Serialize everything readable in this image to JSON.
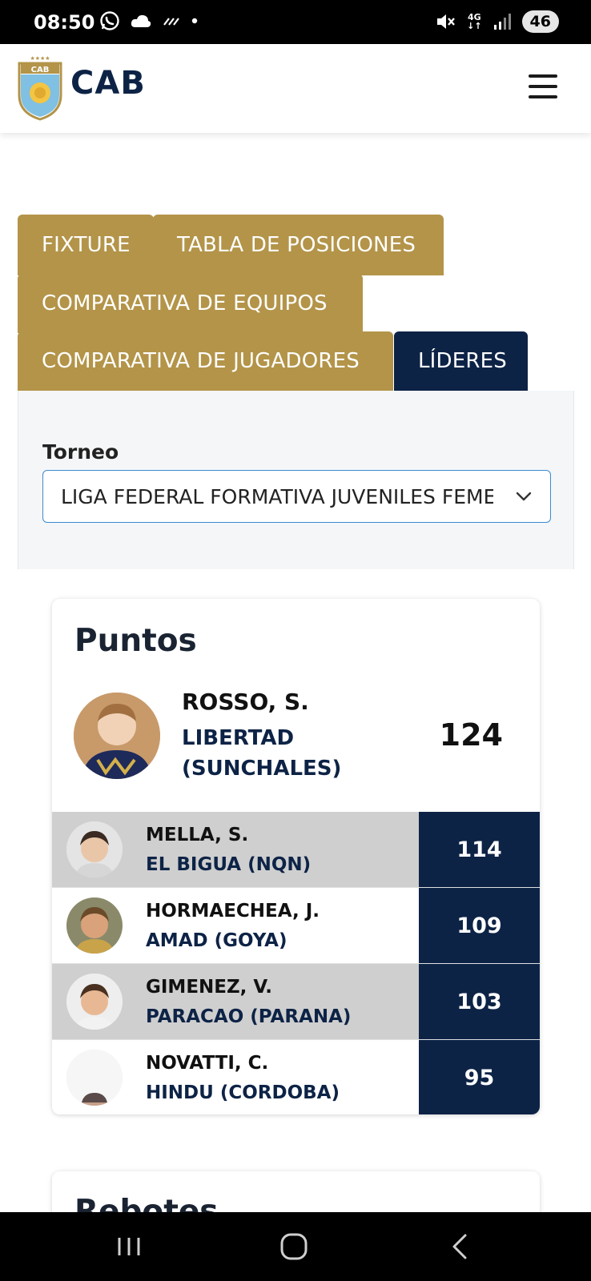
{
  "status_bar": {
    "time": "08:50",
    "network": "4G",
    "battery": "46"
  },
  "header": {
    "logo_text": "CAB",
    "logo_badge": "CAB"
  },
  "tabs": [
    {
      "label": "FIXTURE",
      "active": false
    },
    {
      "label": "TABLA DE POSICIONES",
      "active": false
    },
    {
      "label": "COMPARATIVA DE EQUIPOS",
      "active": false
    },
    {
      "label": "COMPARATIVA DE JUGADORES",
      "active": false
    },
    {
      "label": "LÍDERES",
      "active": true
    }
  ],
  "filter": {
    "label": "Torneo",
    "selected": "LIGA FEDERAL FORMATIVA JUVENILES FEMENINO"
  },
  "leaders": {
    "title": "Puntos",
    "top": {
      "name": "ROSSO, S.",
      "team": "LIBERTAD (SUNCHALES)",
      "value": "124"
    },
    "rows": [
      {
        "name": "MELLA, S.",
        "team": "EL BIGUA (NQN)",
        "value": "114"
      },
      {
        "name": "HORMAECHEA, J.",
        "team": "AMAD (GOYA)",
        "value": "109"
      },
      {
        "name": "GIMENEZ, V.",
        "team": "PARACAO (PARANA)",
        "value": "103"
      },
      {
        "name": "NOVATTI, C.",
        "team": "HINDU (CORDOBA)",
        "value": "95"
      }
    ]
  },
  "next_card": {
    "title": "Rebotes"
  },
  "colors": {
    "navy": "#0d2346",
    "gold": "#b39449",
    "row_gray": "#cfcfcf",
    "panel_bg": "#f4f6f8"
  },
  "icons": {
    "menu": "hamburger-icon",
    "select": "chevron-down-icon",
    "nav": [
      "recents-icon",
      "home-icon",
      "back-icon"
    ]
  }
}
